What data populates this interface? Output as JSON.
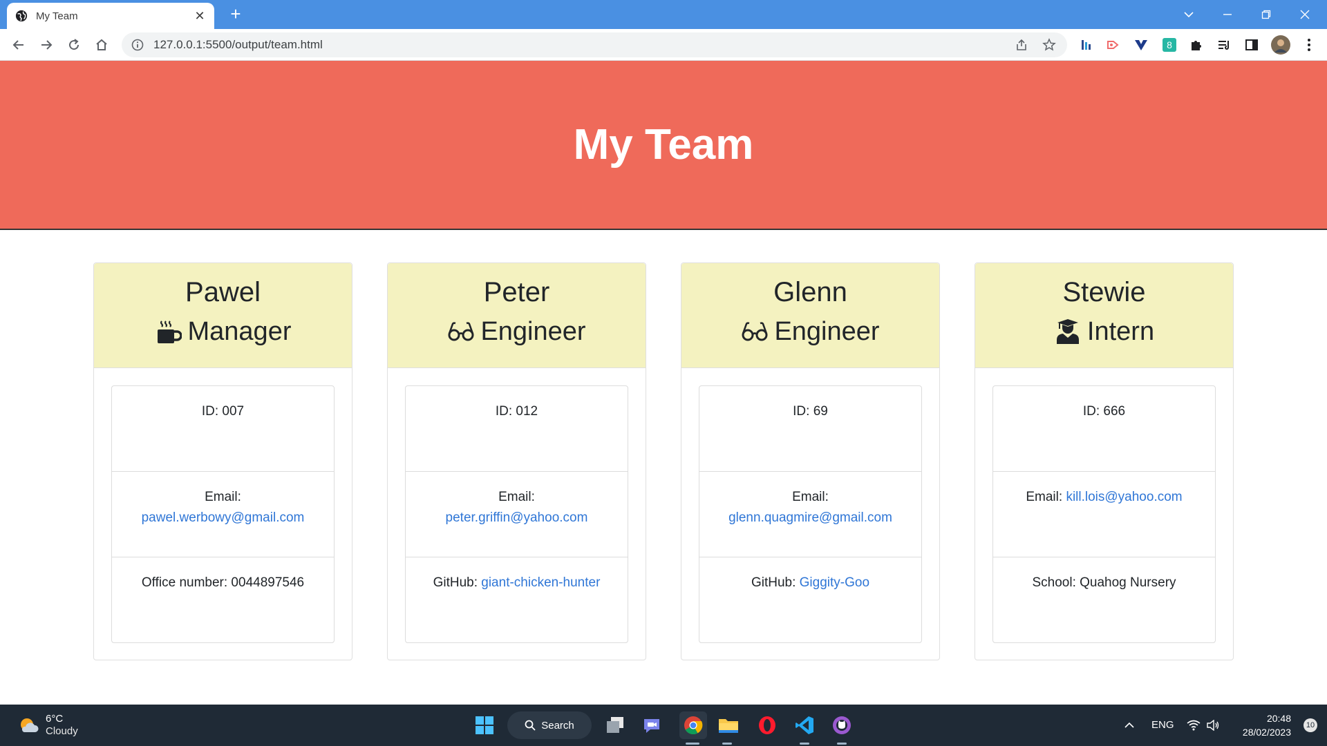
{
  "browser": {
    "tab_title": "My Team",
    "url": "127.0.0.1:5500/output/team.html"
  },
  "page": {
    "title": "My Team"
  },
  "team": [
    {
      "name": "Pawel",
      "role": "Manager",
      "role_icon": "mug-icon",
      "id_label": "ID: 007",
      "email_label": "Email:",
      "email": "pawel.werbowy@gmail.com",
      "extra_label": "Office number: 0044897546",
      "extra_link": ""
    },
    {
      "name": "Peter",
      "role": "Engineer",
      "role_icon": "glasses-icon",
      "id_label": "ID: 012",
      "email_label": "Email:",
      "email": "peter.griffin@yahoo.com",
      "extra_label": "GitHub:",
      "extra_link": "giant-chicken-hunter"
    },
    {
      "name": "Glenn",
      "role": "Engineer",
      "role_icon": "glasses-icon",
      "id_label": "ID: 69",
      "email_label": "Email:",
      "email": "glenn.quagmire@gmail.com",
      "extra_label": "GitHub:",
      "extra_link": "Giggity-Goo"
    },
    {
      "name": "Stewie",
      "role": "Intern",
      "role_icon": "graduate-icon",
      "id_label": "ID: 666",
      "email_label": "Email:",
      "email": "kill.lois@yahoo.com",
      "extra_label": "School: Quahog Nursery",
      "extra_link": ""
    }
  ],
  "taskbar": {
    "temperature": "6°C",
    "condition": "Cloudy",
    "search_label": "Search",
    "language": "ENG",
    "time": "20:48",
    "date": "28/02/2023",
    "notifications": "10"
  },
  "colors": {
    "header_bg": "#ef6a5a",
    "card_header_bg": "#f4f2c0",
    "link": "#2f76d6",
    "tabbar": "#4a90e2"
  }
}
